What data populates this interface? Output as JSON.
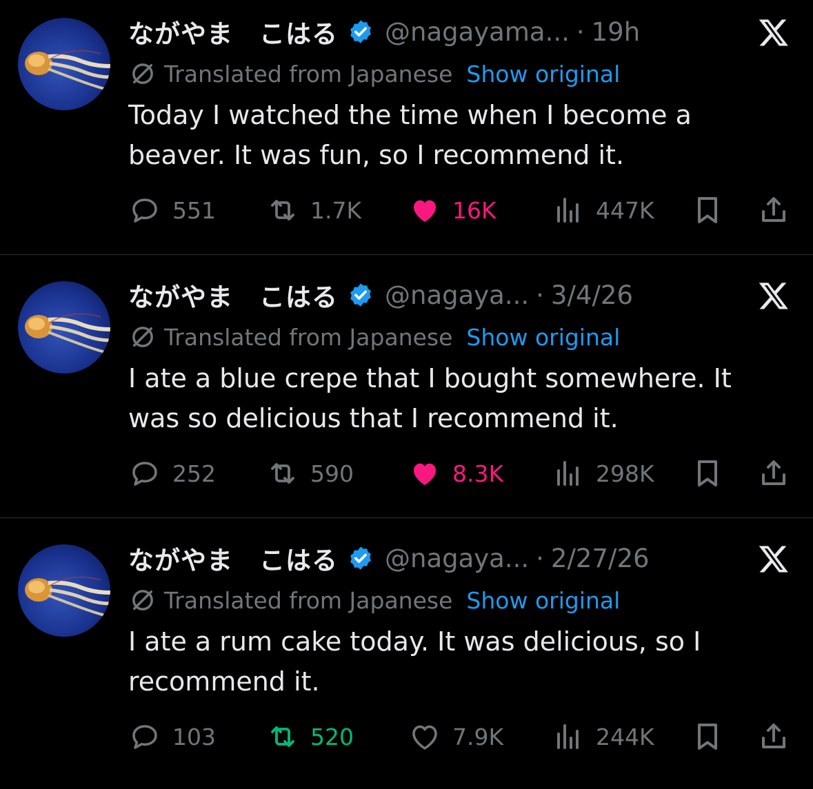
{
  "colors": {
    "background": "#000000",
    "text": "#e7e9ea",
    "muted": "#71767b",
    "link": "#1d9bf0",
    "verified": "#1d9bf0",
    "like_active": "#f91880",
    "retweet_active": "#00ba7c",
    "divider": "#2f3336"
  },
  "icons": {
    "verified": "verified-badge-icon",
    "platform": "x-logo-icon",
    "translate": "translate-icon",
    "reply": "reply-icon",
    "retweet": "retweet-icon",
    "like": "heart-icon",
    "views": "views-chart-icon",
    "bookmark": "bookmark-icon",
    "share": "share-icon"
  },
  "tweets": [
    {
      "display_name": "ながやま　こはる",
      "handle": "@nagayama...",
      "time": "19h",
      "translated_label": "Translated from Japanese",
      "show_original": "Show original",
      "text": "Today I watched the time when I become a beaver. It was fun, so I recommend it.",
      "replies": "551",
      "retweets": "1.7K",
      "likes": "16K",
      "views": "447K",
      "liked": true,
      "retweeted": false
    },
    {
      "display_name": "ながやま　こはる",
      "handle": "@nagaya...",
      "time": "3/4/26",
      "translated_label": "Translated from Japanese",
      "show_original": "Show original",
      "text": "I ate a blue crepe that I bought somewhere. It was so delicious that I recommend it.",
      "replies": "252",
      "retweets": "590",
      "likes": "8.3K",
      "views": "298K",
      "liked": true,
      "retweeted": false
    },
    {
      "display_name": "ながやま　こはる",
      "handle": "@nagaya...",
      "time": "2/27/26",
      "translated_label": "Translated from Japanese",
      "show_original": "Show original",
      "text": "I ate a rum cake today. It was delicious, so I recommend it.",
      "replies": "103",
      "retweets": "520",
      "likes": "7.9K",
      "views": "244K",
      "liked": false,
      "retweeted": true
    }
  ]
}
